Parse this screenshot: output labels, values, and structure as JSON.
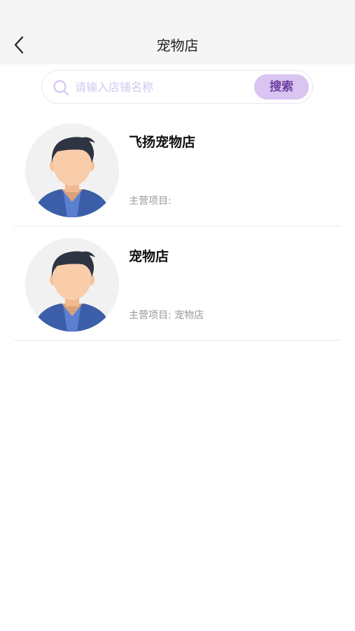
{
  "header": {
    "title": "宠物店"
  },
  "search": {
    "placeholder": "请输入店铺名称",
    "button_label": "搜索"
  },
  "colors": {
    "accent": "#6b3fa0",
    "accent_bg": "#d9c4f2",
    "header_bg": "#f5f5f5"
  },
  "shops": [
    {
      "name": "飞扬宠物店",
      "main_label": "主营项目:",
      "main_value": ""
    },
    {
      "name": "宠物店",
      "main_label": "主营项目:",
      "main_value": "宠物店"
    }
  ]
}
